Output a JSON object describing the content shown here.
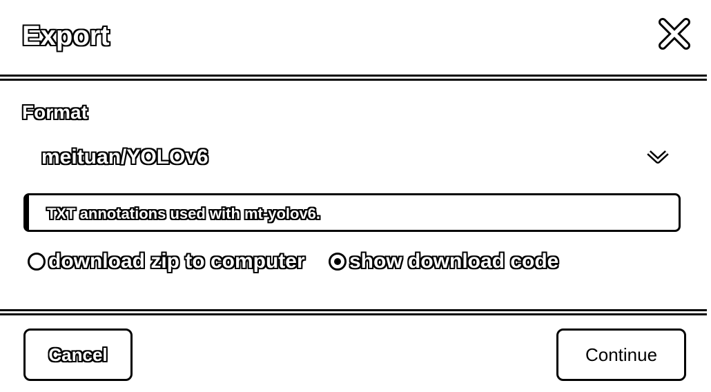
{
  "dialog": {
    "title": "Export",
    "format_label": "Format",
    "format_value": "meituan/YOLOv6",
    "description": "TXT annotations used with mt-yolov6.",
    "options": [
      {
        "label": "download zip to computer",
        "selected": false
      },
      {
        "label": "show download code",
        "selected": true
      }
    ],
    "cancel_label": "Cancel",
    "continue_label": "Continue"
  }
}
